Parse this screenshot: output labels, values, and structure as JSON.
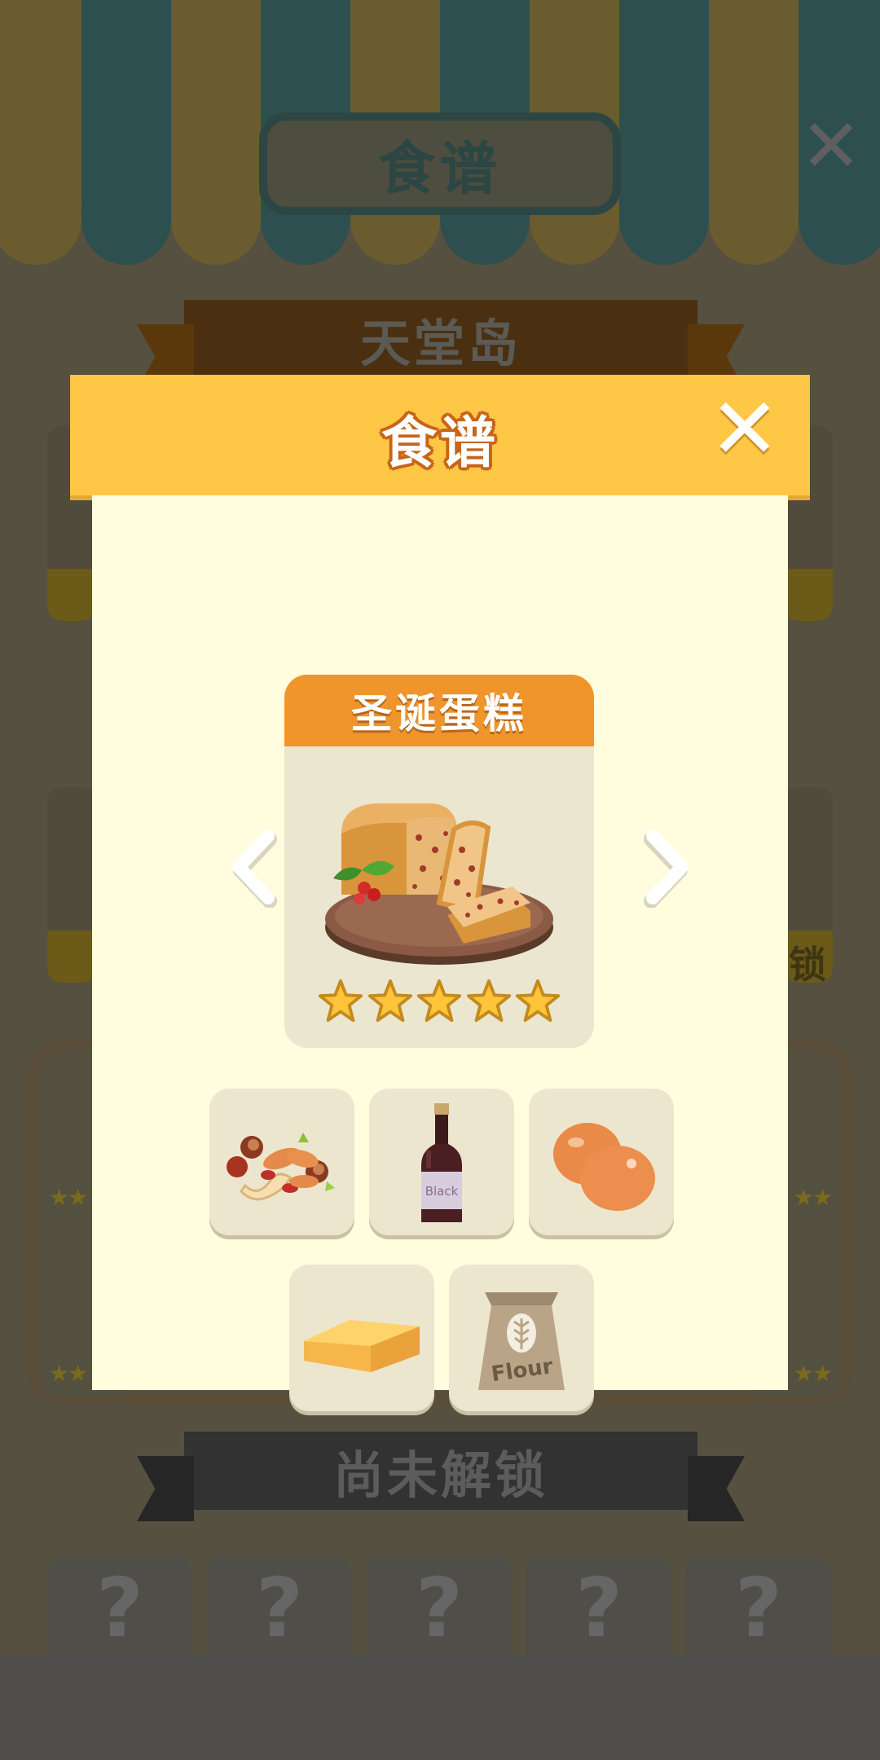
{
  "background": {
    "title": "食谱",
    "section_title": "天堂岛",
    "locked_section_title": "尚未解锁",
    "badge_partial": "锁",
    "locked_placeholder": "?"
  },
  "modal": {
    "title": "食谱",
    "close_icon": "close-icon"
  },
  "recipe": {
    "name": "圣诞蛋糕",
    "rating": 5,
    "max_rating": 5,
    "image": "christmas-fruitcake-on-wooden-board",
    "ingredients": [
      {
        "name": "nuts",
        "icon": "mixed-nuts-icon"
      },
      {
        "name": "black wine",
        "icon": "wine-bottle-icon",
        "label": "Black"
      },
      {
        "name": "eggs",
        "icon": "eggs-icon"
      },
      {
        "name": "butter",
        "icon": "butter-icon"
      },
      {
        "name": "flour",
        "icon": "flour-bag-icon",
        "label": "Flour"
      }
    ]
  },
  "colors": {
    "header": "#ffc746",
    "dish_title_bar": "#ef952b",
    "modal_body": "#fffdde",
    "tile": "#ece6cf",
    "star": "#ffc53a"
  }
}
